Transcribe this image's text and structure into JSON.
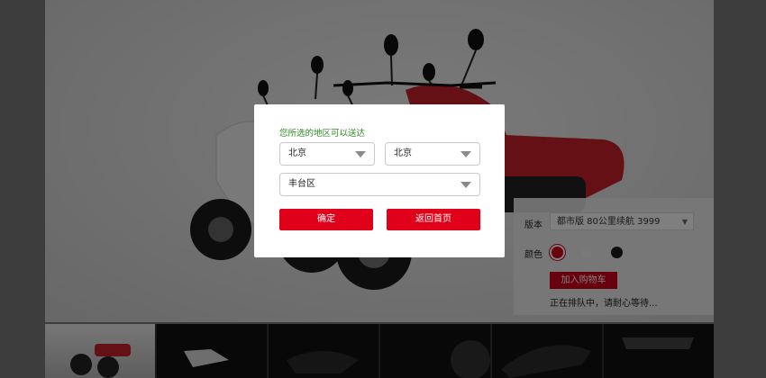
{
  "modal": {
    "title": "您所选的地区可以送达",
    "province": "北京",
    "city": "北京",
    "district": "丰台区",
    "confirm_label": "确定",
    "back_home_label": "返回首页"
  },
  "product": {
    "version_label": "版本",
    "version_value": "都市版  80公里续航  3999",
    "color_label": "颜色",
    "colors": [
      "#d0021b",
      "#f2f2f2",
      "#1a1a1a"
    ],
    "add_cart_label": "加入购物车",
    "queue_text": "正在排队中，请耐心等待..."
  },
  "colors": {
    "accent": "#e1001a",
    "success_text": "#2e8b22"
  }
}
